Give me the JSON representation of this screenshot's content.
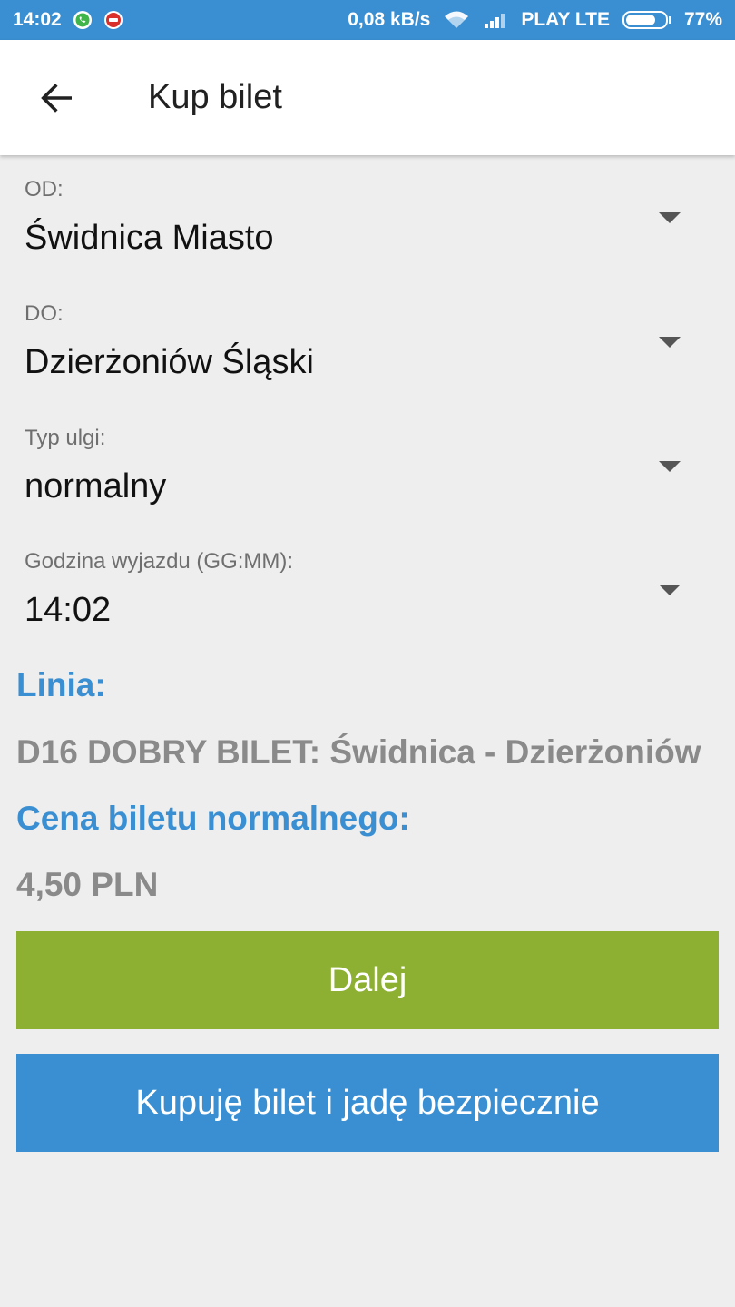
{
  "status_bar": {
    "time": "14:02",
    "speed": "0,08 kB/s",
    "carrier": "PLAY LTE",
    "battery": "77%",
    "battery_level": 0.77
  },
  "app_bar": {
    "title": "Kup bilet"
  },
  "form": {
    "from": {
      "label": "OD:",
      "value": "Świdnica Miasto"
    },
    "to": {
      "label": "DO:",
      "value": "Dzierżoniów Śląski"
    },
    "discount": {
      "label": "Typ ulgi:",
      "value": "normalny"
    },
    "departure": {
      "label": "Godzina wyjazdu (GG:MM):",
      "value": "14:02"
    }
  },
  "info": {
    "line_label": "Linia:",
    "line_value": "D16 DOBRY BILET: Świdnica - Dzierżoniów",
    "price_label": "Cena biletu normalnego:",
    "price_value": "4,50 PLN"
  },
  "buttons": {
    "next": "Dalej",
    "buy_safe": "Kupuję bilet i jadę bezpiecznie"
  },
  "colors": {
    "primary": "#3a8fd2",
    "next_button": "#8db033",
    "value_gray": "#8a8a8a"
  },
  "icons": {
    "back": "arrow-back-icon",
    "whatsapp": "whatsapp-icon",
    "notification": "notification-icon",
    "wifi": "wifi-icon",
    "signal": "signal-icon",
    "battery": "battery-icon",
    "dropdown": "chevron-down-icon"
  }
}
